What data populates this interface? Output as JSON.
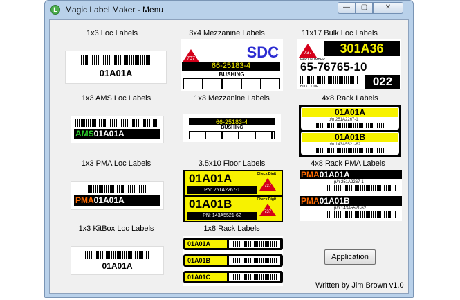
{
  "window": {
    "title": "Magic Label Maker - Menu",
    "app_icon": "app-logo-icon",
    "controls": {
      "minimize": "—",
      "maximize": "▢",
      "close": "✕"
    }
  },
  "tiles": [
    {
      "title": "1x3 Loc Labels",
      "code": "01A01A"
    },
    {
      "title": "3x4 Mezzanine Labels",
      "triangle": "737",
      "brand": "SDC",
      "part": "66-25183-4",
      "desc": "BUSHING"
    },
    {
      "title": "11x17 Bulk Loc Labels",
      "triangle": "737",
      "code": "301A36",
      "small_top": "LOCATION",
      "part_label": "PART NUMBER",
      "part": "65-76765-10",
      "box_label": "BOX CODE",
      "box": "022"
    },
    {
      "title": "1x3 AMS Loc Labels",
      "prefix": "AMS",
      "code": "01A01A"
    },
    {
      "title": "1x3 Mezzanine Labels",
      "part": "66-25183-4",
      "desc": "BUSHING"
    },
    {
      "title": "4x8 Rack Labels",
      "codes": [
        "01A01A",
        "01A01B"
      ],
      "pns": [
        "p/n   251A2267-1",
        "p/n   143A5521-62"
      ]
    },
    {
      "title": "1x3 PMA Loc Labels",
      "prefix": "PMA",
      "code": "01A01A"
    },
    {
      "title": "3.5x10 Floor Labels",
      "codes": [
        "01A01A",
        "01A01B"
      ],
      "pns": [
        "PN: 251A2267-1",
        "PN: 143A5521-62"
      ],
      "check": "Check Digit",
      "triangle": "737"
    },
    {
      "title": "4x8 Rack PMA Labels",
      "prefix": "PMA",
      "codes": [
        "01A01A",
        "01A01B"
      ],
      "pns": [
        "p/n   251A2267-1",
        "p/n   143A5521-62"
      ]
    },
    {
      "title": "1x3 KitBox Loc Labels",
      "code": "01A01A"
    },
    {
      "title": "1x8 Rack Labels",
      "codes": [
        "01A01A",
        "01A01B",
        "01A01C"
      ]
    }
  ],
  "application_button": "Application",
  "credit": "Written by Jim Brown v1.0",
  "colors": {
    "yellow": "#f7f200",
    "red": "#d4001a",
    "green": "#2ccf2c",
    "orange": "#ff6a00",
    "navy": "#2b2bd1"
  }
}
